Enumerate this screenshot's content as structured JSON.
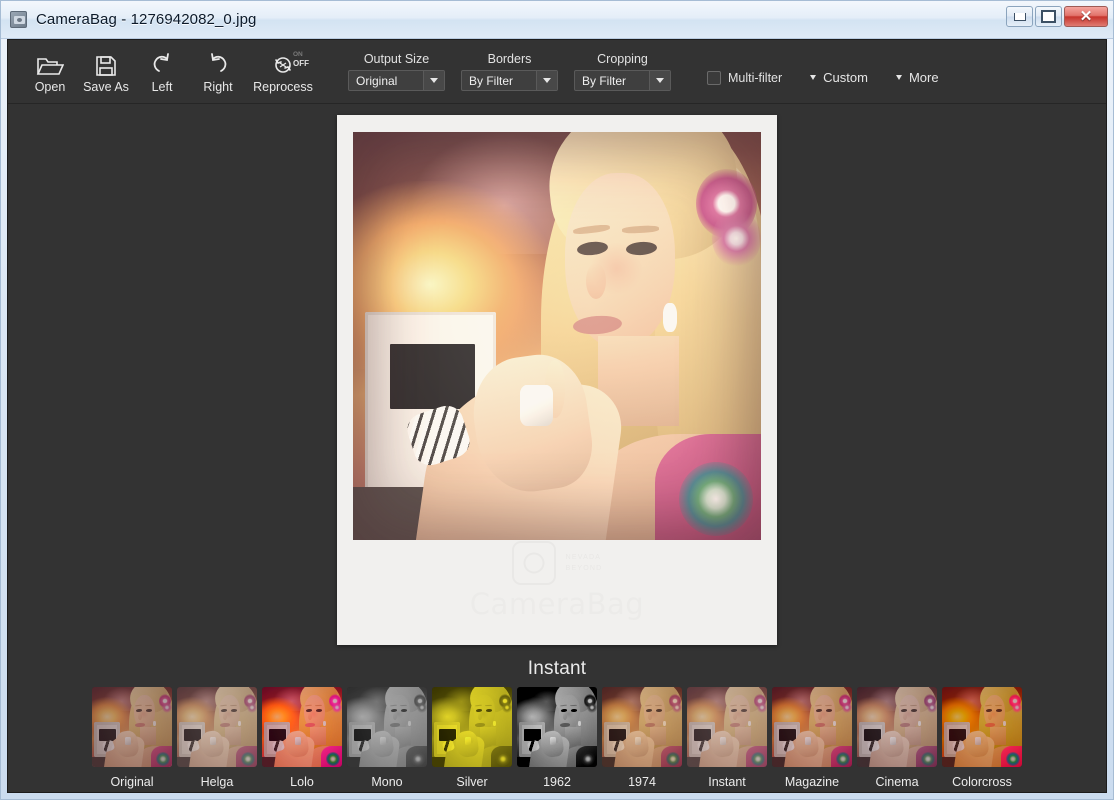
{
  "window": {
    "title": "CameraBag - 1276942082_0.jpg",
    "app_icon": "camerabag-app-icon",
    "minimize_label": "–",
    "maximize_label": "□",
    "close_label": "✕"
  },
  "toolbar": {
    "buttons": [
      {
        "label": "Open",
        "icon": "folder-open-icon"
      },
      {
        "label": "Save As",
        "icon": "floppy-disk-icon"
      },
      {
        "label": "Left",
        "icon": "rotate-left-icon"
      },
      {
        "label": "Right",
        "icon": "rotate-right-icon"
      },
      {
        "label": "Reprocess",
        "icon": "refresh-icon",
        "state_on": "ON",
        "state_off": "OFF",
        "state": "OFF"
      }
    ],
    "dropdowns": [
      {
        "title": "Output Size",
        "value": "Original"
      },
      {
        "title": "Borders",
        "value": "By Filter"
      },
      {
        "title": "Cropping",
        "value": "By Filter"
      }
    ],
    "multifilter": {
      "label": "Multi-filter",
      "checked": false
    },
    "menus": [
      {
        "label": "Custom",
        "icon": "chevron-down-icon"
      },
      {
        "label": "More",
        "icon": "chevron-down-icon"
      }
    ]
  },
  "preview": {
    "active_filter": "Instant",
    "frame_style": "polaroid",
    "watermark": {
      "brand": "CameraBag",
      "tag_line_1": "NEVADA",
      "tag_line_2": "BEYOND",
      "icon": "camera-icon"
    }
  },
  "filters": [
    {
      "label": "Original",
      "class": "f-original",
      "selected": false
    },
    {
      "label": "Helga",
      "class": "f-helga",
      "selected": false
    },
    {
      "label": "Lolo",
      "class": "f-lolo",
      "selected": false
    },
    {
      "label": "Mono",
      "class": "f-mono",
      "selected": false
    },
    {
      "label": "Silver",
      "class": "f-silver",
      "selected": false
    },
    {
      "label": "1962",
      "class": "f-1962",
      "selected": false
    },
    {
      "label": "1974",
      "class": "f-1974",
      "selected": false
    },
    {
      "label": "Instant",
      "class": "f-instant",
      "selected": true
    },
    {
      "label": "Magazine",
      "class": "f-magazine",
      "selected": false
    },
    {
      "label": "Cinema",
      "class": "f-cinema",
      "selected": false
    },
    {
      "label": "Colorcross",
      "class": "f-colorcross",
      "selected": false
    }
  ],
  "colors": {
    "app_background": "#333333",
    "toolbar_text": "#e8e8e8",
    "window_chrome": "#dbe7f4",
    "close_button": "#c6342c",
    "polaroid_paper": "#f1f0ee"
  }
}
